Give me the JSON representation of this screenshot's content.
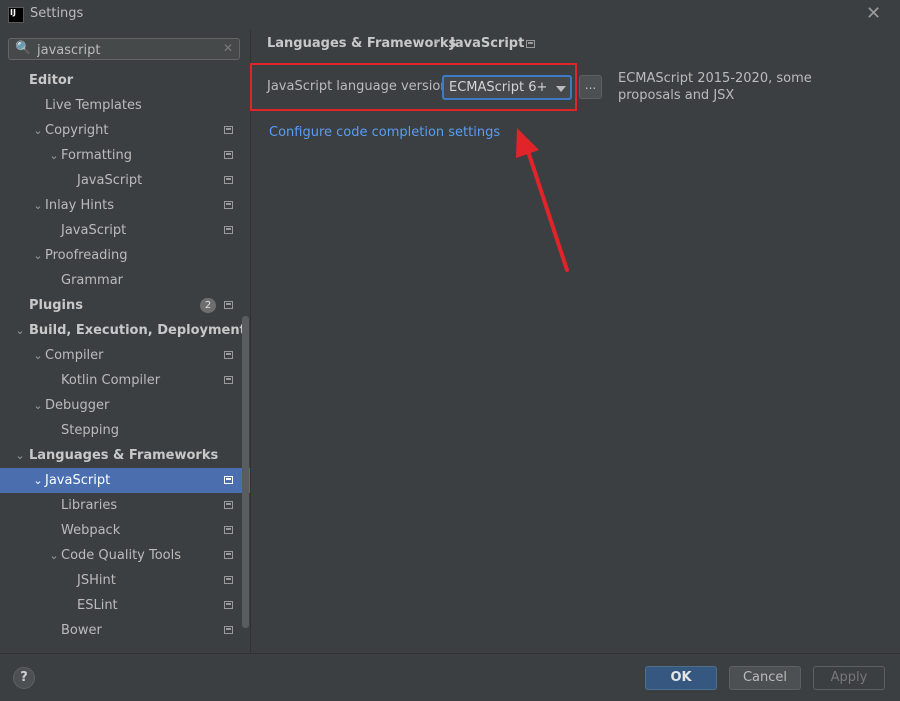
{
  "window": {
    "title": "Settings",
    "close_glyph": "✕"
  },
  "search": {
    "value": "javascript",
    "search_glyph": "🔍",
    "clear_glyph": "✕"
  },
  "tree": [
    {
      "label": "Editor",
      "bold": true
    },
    {
      "label": "Live Templates"
    },
    {
      "label": "Copyright",
      "chevron": "⌄",
      "icon": true
    },
    {
      "label": "Formatting",
      "chevron": "⌄",
      "icon": true
    },
    {
      "label": "JavaScript",
      "icon": true
    },
    {
      "label": "Inlay Hints",
      "chevron": "⌄",
      "icon": true
    },
    {
      "label": "JavaScript",
      "icon": true
    },
    {
      "label": "Proofreading",
      "chevron": "⌄"
    },
    {
      "label": "Grammar"
    },
    {
      "label": "Plugins",
      "bold": true,
      "badge": "2",
      "icon": true
    },
    {
      "label": "Build, Execution, Deployment",
      "bold": true,
      "chevron": "⌄"
    },
    {
      "label": "Compiler",
      "chevron": "⌄",
      "icon": true
    },
    {
      "label": "Kotlin Compiler",
      "icon": true
    },
    {
      "label": "Debugger",
      "chevron": "⌄"
    },
    {
      "label": "Stepping"
    },
    {
      "label": "Languages & Frameworks",
      "bold": true,
      "chevron": "⌄"
    },
    {
      "label": "JavaScript",
      "chevron": "⌄",
      "icon": true,
      "selected": true
    },
    {
      "label": "Libraries",
      "icon": true
    },
    {
      "label": "Webpack",
      "icon": true
    },
    {
      "label": "Code Quality Tools",
      "chevron": "⌄",
      "icon": true
    },
    {
      "label": "JSHint",
      "icon": true
    },
    {
      "label": "ESLint",
      "icon": true
    },
    {
      "label": "Bower",
      "icon": true
    }
  ],
  "content": {
    "breadcrumb_1": "Languages & Frameworks",
    "breadcrumb_sep": "›",
    "breadcrumb_2": "JavaScript",
    "language_version_label": "JavaScript language version",
    "language_version_value": "ECMAScript 6+",
    "more_button_label": "...",
    "description": "ECMAScript 2015-2020, some proposals and JSX",
    "link": "Configure code completion settings"
  },
  "footer": {
    "help_label": "?",
    "ok_label": "OK",
    "cancel_label": "Cancel",
    "apply_label": "Apply"
  },
  "colors": {
    "background": "#3c3f41",
    "selection": "#4b6eaf",
    "link": "#589df6",
    "annotation_red": "#e0242a",
    "ok_button": "#365880"
  }
}
